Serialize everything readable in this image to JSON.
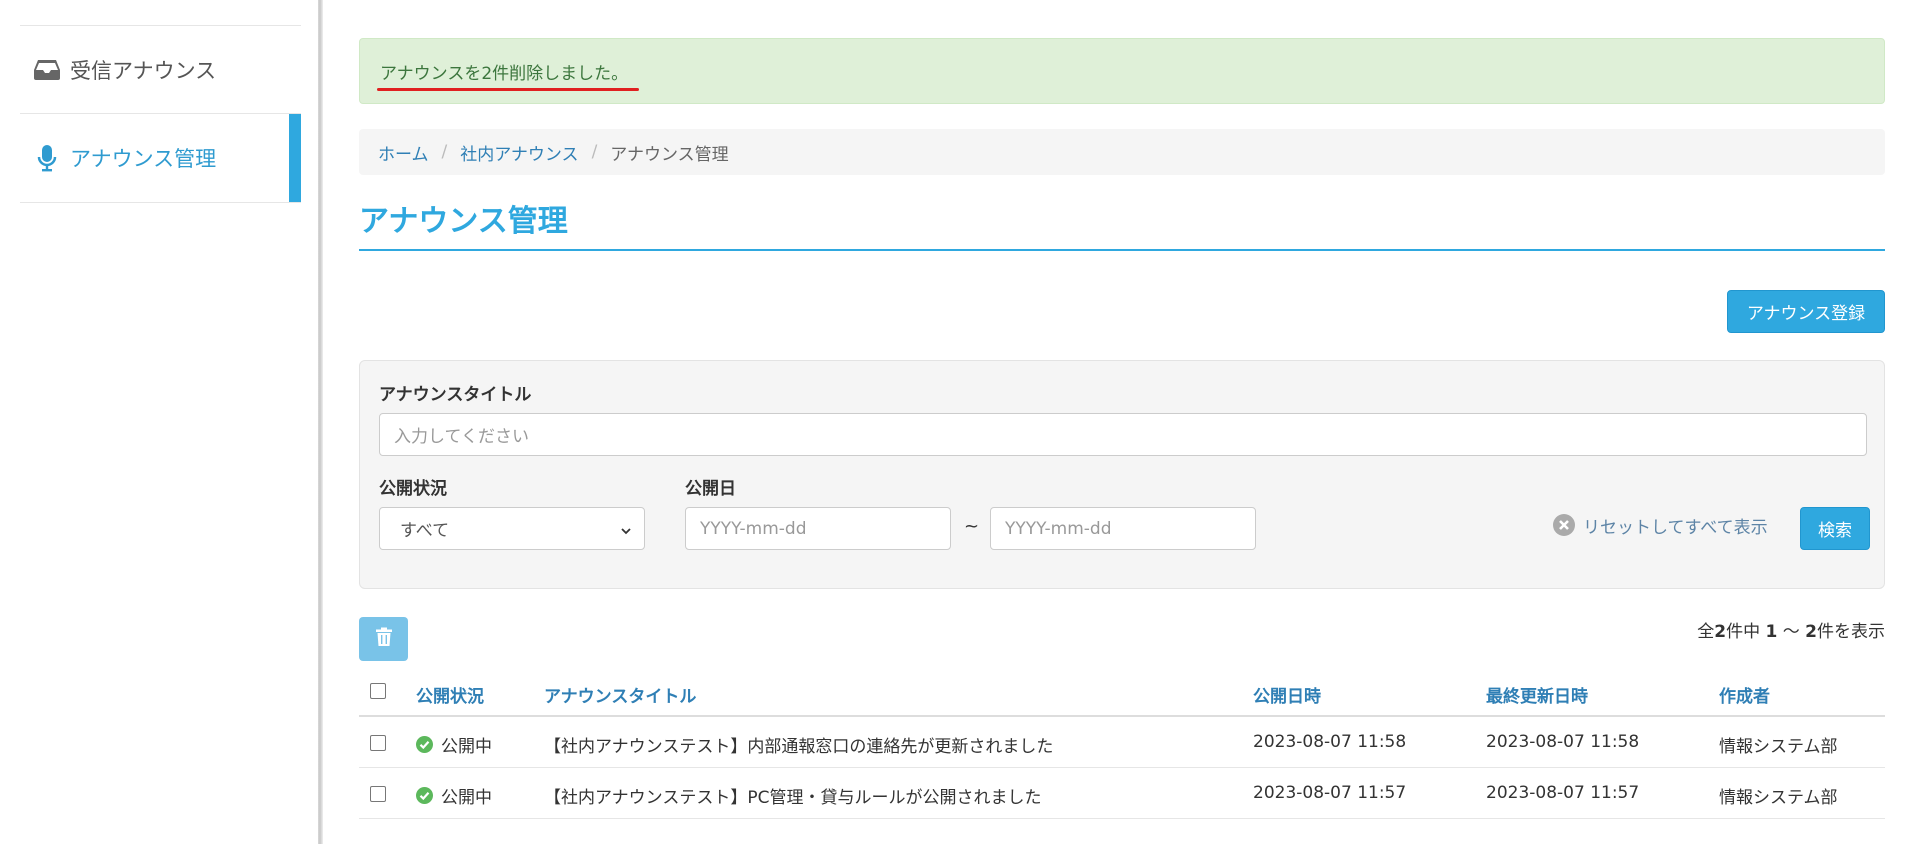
{
  "sidebar": {
    "items": [
      {
        "label": "受信アナウンス",
        "icon": "inbox-icon"
      },
      {
        "label": "アナウンス管理",
        "icon": "microphone-icon",
        "active": true
      }
    ]
  },
  "alert": {
    "message": "アナウンスを2件削除しました。"
  },
  "breadcrumb": {
    "home": "ホーム",
    "section": "社内アナウンス",
    "current": "アナウンス管理"
  },
  "page": {
    "title": "アナウンス管理"
  },
  "actions": {
    "register_label": "アナウンス登録"
  },
  "search": {
    "title_label": "アナウンスタイトル",
    "title_placeholder": "入力してください",
    "status_label": "公開状況",
    "status_selected": "すべて",
    "date_label": "公開日",
    "date_from_placeholder": "YYYY-mm-dd",
    "date_to_placeholder": "YYYY-mm-dd",
    "tilde": "~",
    "reset_label": "リセットしてすべて表示",
    "search_label": "検索"
  },
  "results": {
    "total_prefix": "全",
    "total": "2",
    "total_mid": "件中",
    "from": "1",
    "range_sep": "〜",
    "to": "2",
    "suffix": "件を表示"
  },
  "table": {
    "headers": {
      "status": "公開状況",
      "title": "アナウンスタイトル",
      "published": "公開日時",
      "updated": "最終更新日時",
      "author": "作成者"
    },
    "rows": [
      {
        "status": "公開中",
        "title": "【社内アナウンステスト】内部通報窓口の連絡先が更新されました",
        "published": "2023-08-07 11:58",
        "updated": "2023-08-07 11:58",
        "author": "情報システム部"
      },
      {
        "status": "公開中",
        "title": "【社内アナウンステスト】PC管理・貸与ルールが公開されました",
        "published": "2023-08-07 11:57",
        "updated": "2023-08-07 11:57",
        "author": "情報システム部"
      }
    ]
  },
  "colors": {
    "accent": "#2fa8df",
    "success_bg": "#dff0d8",
    "success_text": "#3c763d",
    "link": "#2f7fb5",
    "status_ok": "#5cb85c"
  }
}
